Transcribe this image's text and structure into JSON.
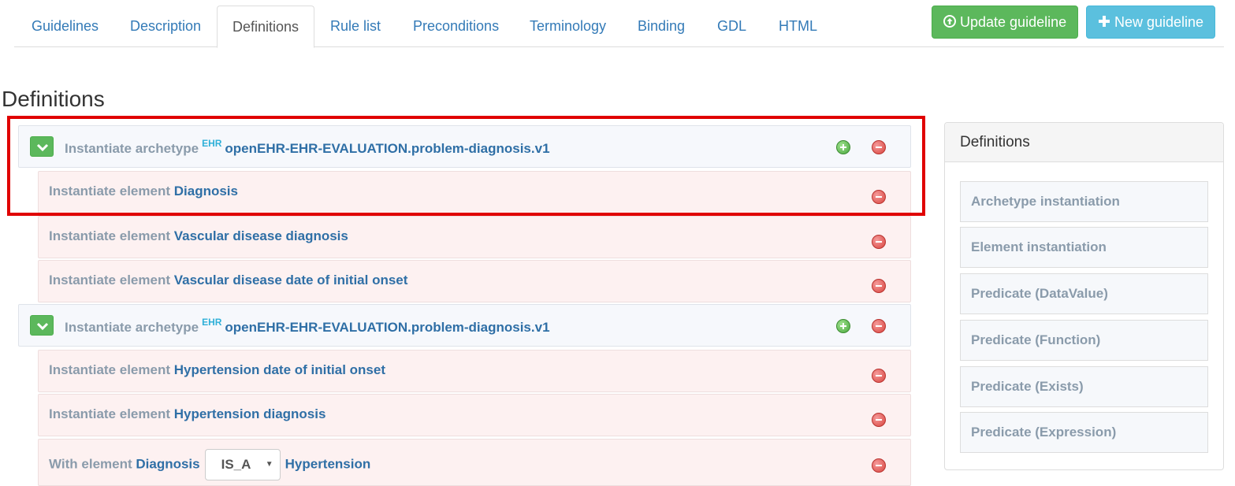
{
  "tabs": [
    {
      "label": "Guidelines"
    },
    {
      "label": "Description"
    },
    {
      "label": "Definitions"
    },
    {
      "label": "Rule list"
    },
    {
      "label": "Preconditions"
    },
    {
      "label": "Terminology"
    },
    {
      "label": "Binding"
    },
    {
      "label": "GDL"
    },
    {
      "label": "HTML"
    }
  ],
  "active_tab": "Definitions",
  "buttons": {
    "update": "Update guideline",
    "new": "New guideline"
  },
  "page_title": "Definitions",
  "definitions": {
    "archetype1": {
      "prefix": "Instantiate archetype",
      "badge": "EHR",
      "id": "openEHR-EHR-EVALUATION.problem-diagnosis.v1",
      "elements": [
        {
          "prefix": "Instantiate element",
          "name": "Diagnosis"
        },
        {
          "prefix": "Instantiate element",
          "name": "Vascular disease diagnosis"
        },
        {
          "prefix": "Instantiate element",
          "name": "Vascular disease date of initial onset"
        }
      ]
    },
    "archetype2": {
      "prefix": "Instantiate archetype",
      "badge": "EHR",
      "id": "openEHR-EHR-EVALUATION.problem-diagnosis.v1",
      "elements": [
        {
          "prefix": "Instantiate element",
          "name": "Hypertension date of initial onset"
        },
        {
          "prefix": "Instantiate element",
          "name": "Hypertension diagnosis"
        }
      ],
      "predicate": {
        "prefix": "With element",
        "name": "Diagnosis",
        "operator": "IS_A",
        "value": "Hypertension"
      }
    }
  },
  "sidebar": {
    "title": "Definitions",
    "items": [
      {
        "label": "Archetype instantiation"
      },
      {
        "label": "Element instantiation"
      },
      {
        "label": "Predicate (DataValue)"
      },
      {
        "label": "Predicate (Function)"
      },
      {
        "label": "Predicate (Exists)"
      },
      {
        "label": "Predicate (Expression)"
      }
    ]
  },
  "colors": {
    "link": "#337ab7",
    "success": "#5cb85c",
    "info": "#5bc0de",
    "highlight": "#e00000"
  },
  "icons": {
    "update": "circle-arrow-up-icon",
    "new": "plus-icon",
    "toggle": "chevron-down-icon",
    "add": "add-circle-icon",
    "remove": "remove-circle-icon"
  }
}
